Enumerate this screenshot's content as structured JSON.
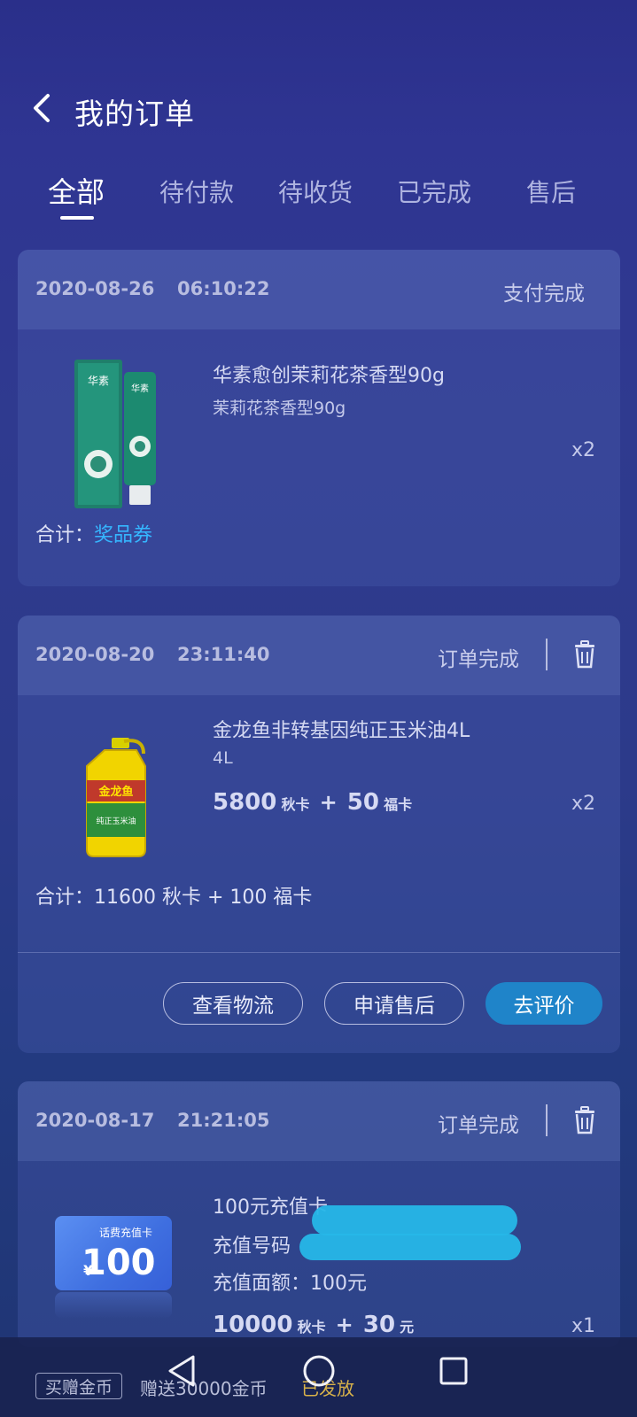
{
  "header": {
    "title": "我的订单",
    "tabs": [
      "全部",
      "待付款",
      "待收货",
      "已完成",
      "售后"
    ]
  },
  "orders": [
    {
      "date": "2020-08-26",
      "time": "06:10:22",
      "status": "支付完成",
      "product_name": "华素愈创茉莉花茶香型90g",
      "product_spec": "茉莉花茶香型90g",
      "qty": "x2",
      "total_label": "合计：",
      "total_value": "奖品券"
    },
    {
      "date": "2020-08-20",
      "time": "23:11:40",
      "status": "订单完成",
      "product_name": "金龙鱼非转基因纯正玉米油4L",
      "product_spec": "4L",
      "price_main": "5800",
      "price_main_unit": "秋卡",
      "price_plus": "+",
      "price_sub": "50",
      "price_sub_unit": "福卡",
      "qty": "x2",
      "total_label": "合计：",
      "total_value": "11600 秋卡 + 100 福卡",
      "buttons": [
        "查看物流",
        "申请售后",
        "去评价"
      ]
    },
    {
      "date": "2020-08-17",
      "time": "21:21:05",
      "status": "订单完成",
      "product_name": "100元充值卡",
      "line2": "充值号码",
      "line3": "充值面额：100元",
      "price_main": "10000",
      "price_main_unit": "秋卡",
      "price_plus": "+",
      "price_sub": "30",
      "price_sub_unit": "元",
      "qty": "x1",
      "card_label": "话费充值卡",
      "card_amount": "100",
      "card_yen": "¥"
    }
  ],
  "bottom": {
    "tag": "买赠金币",
    "text": "赠送30000金币",
    "status": "已发放"
  },
  "colors": {
    "accent": "#1f84c9",
    "voucher": "#35b6ff",
    "promo_status": "#d8b24a"
  }
}
